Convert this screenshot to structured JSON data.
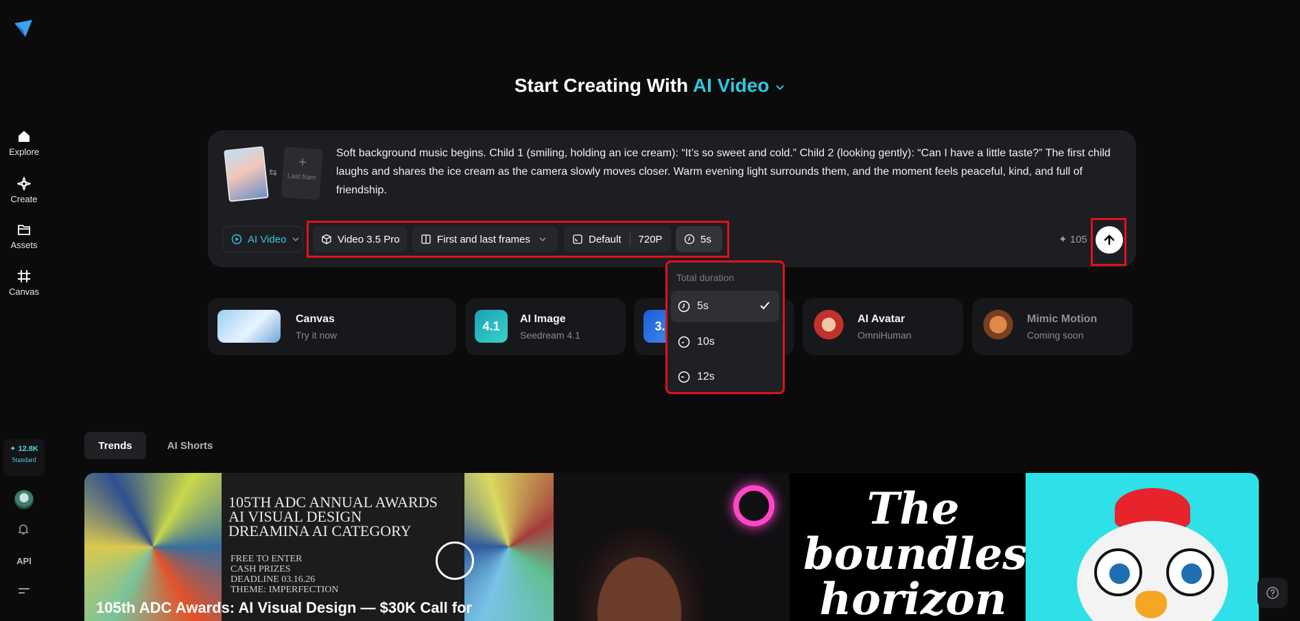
{
  "sidebar": {
    "logo_icon": "paper-plane-logo",
    "items": [
      {
        "label": "Explore",
        "icon": "home-icon"
      },
      {
        "label": "Create",
        "icon": "sparkle-icon"
      },
      {
        "label": "Assets",
        "icon": "folder-icon"
      },
      {
        "label": "Canvas",
        "icon": "grid-icon"
      }
    ],
    "credits": {
      "amount": "✦ 12.8K",
      "plan": "Standard"
    },
    "api_label": "API"
  },
  "heading": {
    "prefix": "Start Creating With",
    "mode": "AI Video"
  },
  "prompt": {
    "text": "Soft background music begins. Child 1 (smiling, holding an ice cream): “It’s so sweet and cold.” Child 2 (looking gently): “Can I have a little taste?” The first child laughs and shares the ice cream as the camera slowly moves closer. Warm evening light surrounds them, and the moment feels peaceful, kind, and full of friendship.",
    "last_frame_label": "Last fram"
  },
  "toolbar": {
    "mode_label": "AI Video",
    "model_label": "Video 3.5 Pro",
    "frames_label": "First and last frames",
    "ratio_label": "Default",
    "resolution_label": "720P",
    "duration_label": "5s",
    "cost": "✦ 105"
  },
  "duration_dropdown": {
    "title": "Total duration",
    "options": [
      {
        "label": "5s",
        "selected": true
      },
      {
        "label": "10s",
        "selected": false
      },
      {
        "label": "12s",
        "selected": false
      }
    ]
  },
  "features": [
    {
      "title": "Canvas",
      "subtitle": "Try it now"
    },
    {
      "title": "AI Image",
      "subtitle": "Seedream 4.1",
      "badge": "4.1"
    },
    {
      "title": "",
      "subtitle": "",
      "badge": "3."
    },
    {
      "title": "AI Avatar",
      "subtitle": "OmniHuman"
    },
    {
      "title": "Mimic Motion",
      "subtitle": "Coming soon"
    }
  ],
  "tabs": [
    {
      "label": "Trends",
      "active": true
    },
    {
      "label": "AI Shorts",
      "active": false
    }
  ],
  "gallery": {
    "card1_heading": [
      "105TH ADC ANNUAL AWARDS",
      "AI VISUAL DESIGN",
      "DREAMINA AI CATEGORY"
    ],
    "card1_details": [
      "FREE TO ENTER",
      "CASH PRIZES",
      "DEADLINE 03.16.26",
      "THEME: IMPERFECTION"
    ],
    "card1_caption": "105th ADC Awards: AI Visual Design — $30K Call for",
    "card3_text": "The boundless horizon"
  },
  "colors": {
    "accent": "#2ec8e0",
    "highlight": "#e0121b",
    "background": "#0b0b0c",
    "card": "#1d1e22"
  }
}
